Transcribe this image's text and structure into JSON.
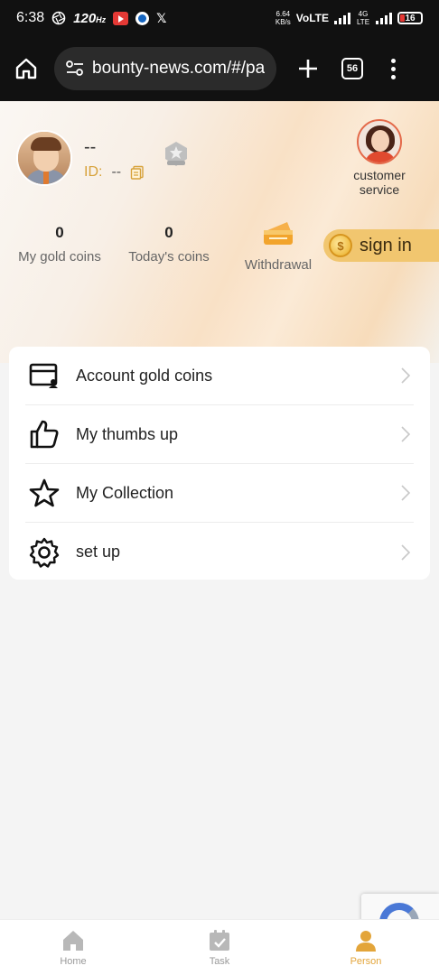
{
  "status_bar": {
    "time": "6:38",
    "refresh_rate": "120",
    "refresh_unit": "Hz",
    "net_speed_value": "6.64",
    "net_speed_unit": "KB/s",
    "network_label": "VoLTE",
    "lte_label": "4G LTE",
    "battery": "16"
  },
  "browser": {
    "url": "bounty-news.com/#/pa",
    "tab_count": "56"
  },
  "profile": {
    "username": "--",
    "id_label": "ID:",
    "id_value": "--"
  },
  "customer_service": {
    "label": "customer service"
  },
  "stats": {
    "gold_coins_value": "0",
    "gold_coins_label": "My gold coins",
    "today_coins_value": "0",
    "today_coins_label": "Today's coins",
    "withdrawal_label": "Withdrawal"
  },
  "signin": {
    "coin_symbol": "$",
    "label": "sign in"
  },
  "menu": {
    "items": [
      {
        "label": "Account gold coins",
        "icon": "wallet-icon"
      },
      {
        "label": "My thumbs up",
        "icon": "thumbs-up-icon"
      },
      {
        "label": "My Collection",
        "icon": "star-icon"
      },
      {
        "label": "set up",
        "icon": "gear-icon"
      }
    ]
  },
  "bottom_nav": {
    "items": [
      {
        "label": "Home",
        "icon": "home-icon",
        "active": false
      },
      {
        "label": "Task",
        "icon": "task-icon",
        "active": false
      },
      {
        "label": "Person",
        "icon": "person-icon",
        "active": true
      }
    ]
  },
  "colors": {
    "accent_gold": "#e3a53a",
    "signin_bg": "#f1c66f",
    "id_label": "#d7a23a"
  }
}
